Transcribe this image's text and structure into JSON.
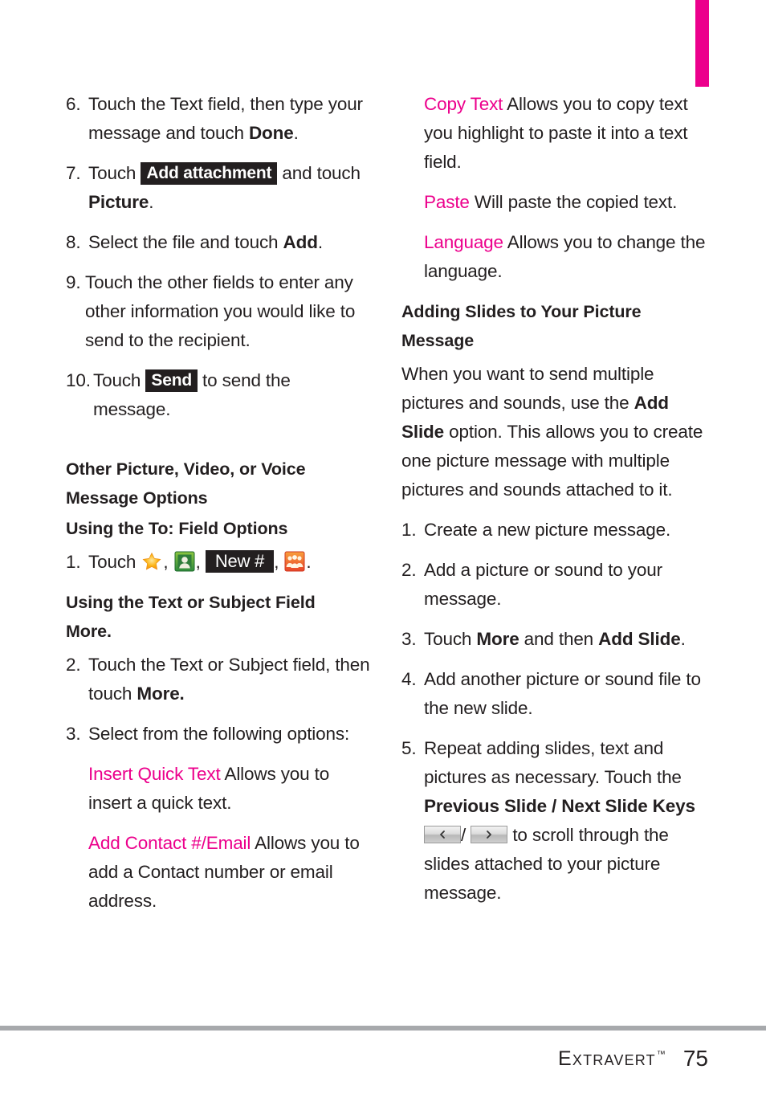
{
  "page": {
    "number": "75",
    "brand": "Extravert",
    "trademark": "™",
    "accent_color": "#ec008c",
    "chip_color": "#231f20",
    "rule_color": "#a7a9ac"
  },
  "left_column": {
    "steps": [
      {
        "num": "6.",
        "parts": [
          {
            "t": "text",
            "v": "Touch the Text field, then type your message and touch "
          },
          {
            "t": "bold",
            "v": "Done"
          },
          {
            "t": "text",
            "v": "."
          }
        ]
      },
      {
        "num": "7.",
        "parts": [
          {
            "t": "text",
            "v": "Touch "
          },
          {
            "t": "chip",
            "v": "Add attachment"
          },
          {
            "t": "text",
            "v": " and touch "
          },
          {
            "t": "bold",
            "v": "Picture"
          },
          {
            "t": "text",
            "v": "."
          }
        ]
      },
      {
        "num": "8.",
        "parts": [
          {
            "t": "text",
            "v": "Select the file and touch "
          },
          {
            "t": "bold",
            "v": "Add"
          },
          {
            "t": "text",
            "v": "."
          }
        ]
      },
      {
        "num": "9.",
        "parts": [
          {
            "t": "text",
            "v": "Touch the other fields to enter any other information you would like to send to the recipient."
          }
        ]
      },
      {
        "num": "10.",
        "parts": [
          {
            "t": "text",
            "v": "Touch "
          },
          {
            "t": "chip",
            "v": "Send"
          },
          {
            "t": "text",
            "v": " to send the message."
          }
        ]
      }
    ],
    "heading_other_options_line1": "Other Picture, Video, or Voice",
    "heading_other_options_line2": "Message Options",
    "heading_to_field": "Using the To: Field Options",
    "step_icons": {
      "num": "1.",
      "lead": "Touch ",
      "icons": [
        {
          "name": "favorites-star-icon",
          "sep": ","
        },
        {
          "name": "contacts-person-icon",
          "sep": ","
        },
        {
          "name": "new-number-chip",
          "label": "New #",
          "sep": ","
        },
        {
          "name": "contact-groups-icon",
          "sep": "."
        }
      ]
    },
    "heading_text_subject_line1": "Using the Text or Subject Field",
    "heading_text_subject_line2": "More.",
    "steps_2": [
      {
        "num": "2.",
        "parts": [
          {
            "t": "text",
            "v": "Touch the Text or Subject field, then touch "
          },
          {
            "t": "bold",
            "v": "More."
          }
        ]
      },
      {
        "num": "3.",
        "parts": [
          {
            "t": "text",
            "v": "Select from the following options:"
          }
        ]
      }
    ],
    "definitions": [
      {
        "term": "Insert Quick Text",
        "desc": " Allows you to insert a quick text."
      },
      {
        "term": "Add Contact #/Email",
        "desc": " Allows you to add a Contact number or email address."
      }
    ]
  },
  "right_column": {
    "definitions": [
      {
        "term": "Copy Text",
        "desc": " Allows you to copy text you highlight to paste it into a text field."
      },
      {
        "term": "Paste",
        "desc": " Will paste the copied text."
      },
      {
        "term": "Language",
        "desc": " Allows you to change the language."
      }
    ],
    "heading_adding_slides_line1": "Adding Slides to Your Picture",
    "heading_adding_slides_line2": "Message",
    "intro": [
      {
        "t": "text",
        "v": "When you want to send multiple pictures and sounds, use the "
      },
      {
        "t": "bold",
        "v": "Add Slide"
      },
      {
        "t": "text",
        "v": " option. This allows you to create one picture message with multiple pictures and sounds attached to it."
      }
    ],
    "steps": [
      {
        "num": "1.",
        "parts": [
          {
            "t": "text",
            "v": "Create a new picture message."
          }
        ]
      },
      {
        "num": "2.",
        "parts": [
          {
            "t": "text",
            "v": "Add a picture or sound to your message."
          }
        ]
      },
      {
        "num": "3.",
        "parts": [
          {
            "t": "text",
            "v": "Touch "
          },
          {
            "t": "bold",
            "v": "More"
          },
          {
            "t": "text",
            "v": " and then "
          },
          {
            "t": "bold",
            "v": "Add Slide"
          },
          {
            "t": "text",
            "v": "."
          }
        ]
      },
      {
        "num": "4.",
        "parts": [
          {
            "t": "text",
            "v": "Add another picture or sound file to the new slide."
          }
        ]
      },
      {
        "num": "5.",
        "parts": [
          {
            "t": "text",
            "v": "Repeat adding slides, text and pictures as necessary. Touch the "
          },
          {
            "t": "bold",
            "v": "Previous Slide / Next Slide Keys"
          },
          {
            "t": "key",
            "v": "prev"
          },
          {
            "t": "text",
            "v": "/"
          },
          {
            "t": "key",
            "v": "next"
          },
          {
            "t": "text",
            "v": " to scroll through the slides attached to your picture message."
          }
        ]
      }
    ]
  }
}
